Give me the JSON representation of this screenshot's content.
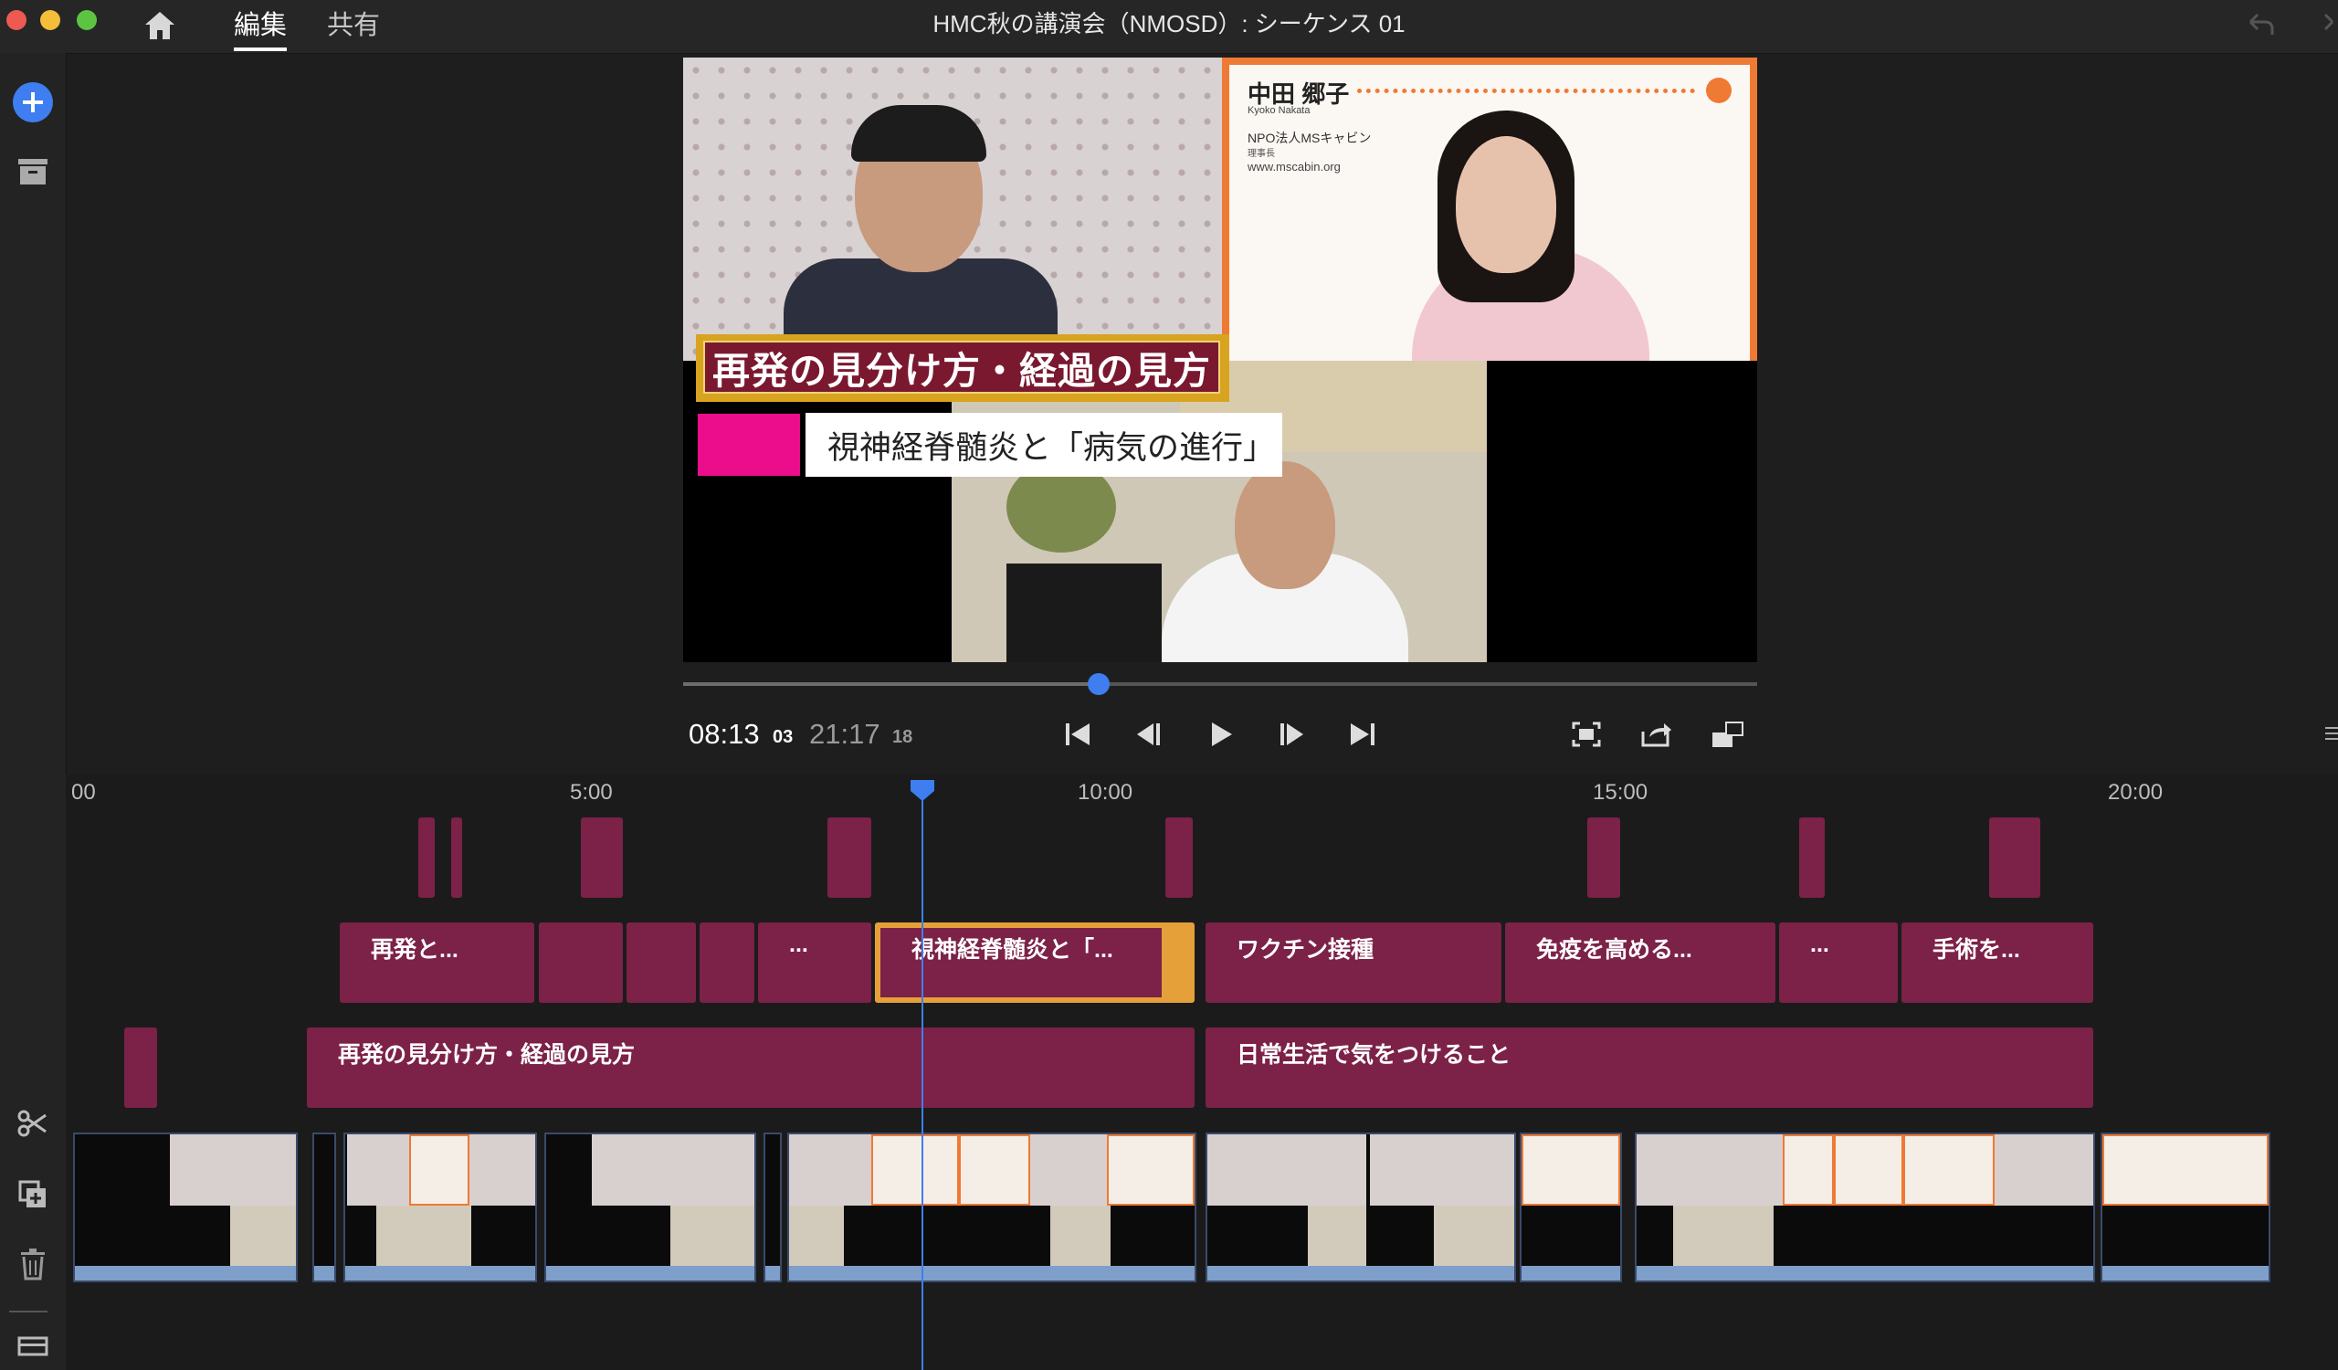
{
  "window": {
    "title": "HMC秋の講演会（NMOSD）: シーケンス 01"
  },
  "tabs": {
    "edit": "編集",
    "share": "共有"
  },
  "icons": {
    "home": "home-icon",
    "add": "add-icon",
    "archive": "archive-icon",
    "scissors": "scissors-icon",
    "duplicate": "duplicate-icon",
    "trash": "trash-icon",
    "undo": "undo-icon",
    "panel": "panel-icon"
  },
  "colors": {
    "accent": "#3e7ef0",
    "clip": "#7c2147",
    "selected": "#e5a03a",
    "caption_pink": "#ec0d8c"
  },
  "viewer": {
    "caption_main": "再発の見分け方・経過の見方",
    "caption_sub": "視神経脊髄炎と「病気の進行」",
    "speaker": {
      "name": "中田 郷子",
      "romaji": "Kyoko Nakata",
      "org": "NPO法人MSキャビン",
      "role": "理事長",
      "url": "www.mscabin.org"
    }
  },
  "transport": {
    "current": "08:13",
    "current_frames": "03",
    "total": "21:17",
    "total_frames": "18",
    "progress": 0.387
  },
  "timeline": {
    "ruler": [
      "00",
      "5:00",
      "10:00",
      "15:00",
      "20:00"
    ],
    "track2": [
      "再発と...",
      "...",
      "視神経脊髄炎と「...",
      "ワクチン接種",
      "免疫を高める...",
      "...",
      "手術を..."
    ],
    "track1": [
      "再発の見分け方・経過の見方",
      "日常生活で気をつけること"
    ]
  }
}
